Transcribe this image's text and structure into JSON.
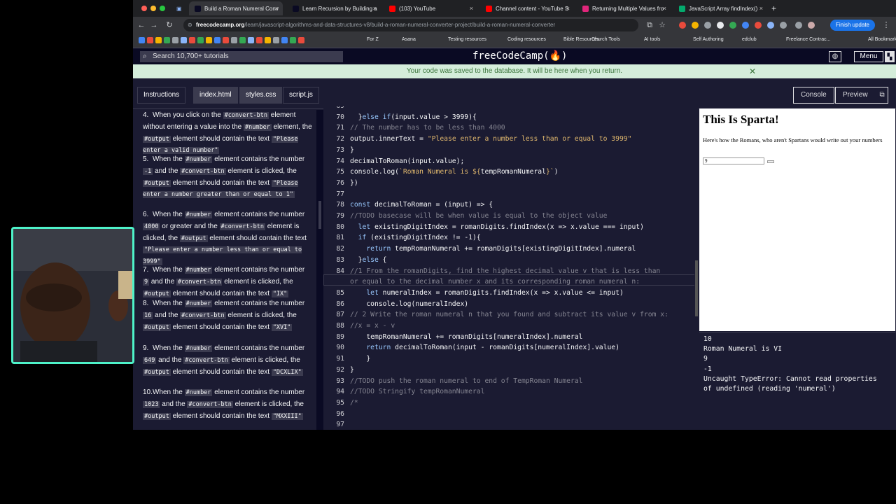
{
  "browser": {
    "tabs": [
      {
        "title": "Build a Roman Numeral Conv",
        "active": true,
        "fav_color": "#0a0a23"
      },
      {
        "title": "Learn Recursion by Building a",
        "active": false,
        "fav_color": "#0a0a23"
      },
      {
        "title": "(103) YouTube",
        "active": false,
        "fav_color": "#ff0000"
      },
      {
        "title": "Channel content - YouTube S",
        "active": false,
        "fav_color": "#ff0000"
      },
      {
        "title": "Returning Multiple Values fro",
        "active": false,
        "fav_color": "#e0267b"
      },
      {
        "title": "JavaScript Array findIndex()",
        "active": false,
        "fav_color": "#04aa6d"
      }
    ],
    "new_tab": "+",
    "url_host": "freecodecamp.org",
    "url_path": "/learn/javascript-algorithms-and-data-structures-v8/build-a-roman-numeral-converter-project/build-a-roman-numeral-converter",
    "finish_update": "Finish update",
    "bookmarks": [
      "For Z",
      "Asana",
      "Testing resources",
      "Coding resources",
      "Bible Resources",
      "Church Tools",
      "AI tools",
      "Self Authoring",
      "edclub",
      "Freelance Contrac...",
      "All Bookmarks"
    ]
  },
  "fcc": {
    "search_placeholder": "Search 10,700+ tutorials",
    "logo": "freeCodeCamp(🔥)",
    "menu": "Menu",
    "flash": "Your code was saved to the database. It will be here when you return.",
    "flash_close": "✕",
    "tabs": [
      "Instructions",
      "index.html",
      "styles.css",
      "script.js"
    ],
    "right_tabs": [
      "Console",
      "Preview"
    ]
  },
  "instructions": [
    {
      "n": "4.",
      "parts": [
        [
          "t",
          "When you click on the "
        ],
        [
          "c",
          "#convert-btn"
        ],
        [
          "t",
          " element without entering a value into the "
        ],
        [
          "c",
          "#number"
        ],
        [
          "t",
          " element, the "
        ],
        [
          "c",
          "#output"
        ],
        [
          "t",
          " element should contain the text "
        ],
        [
          "c",
          "\"Please enter a valid number\""
        ]
      ]
    },
    {
      "n": "5.",
      "parts": [
        [
          "t",
          "When the "
        ],
        [
          "c",
          "#number"
        ],
        [
          "t",
          " element contains the number "
        ],
        [
          "c",
          "-1"
        ],
        [
          "t",
          " and the "
        ],
        [
          "c",
          "#convert-btn"
        ],
        [
          "t",
          " element is clicked, the "
        ],
        [
          "c",
          "#output"
        ],
        [
          "t",
          " element should contain the text "
        ],
        [
          "c",
          "\"Please enter a number greater than or equal to 1\""
        ]
      ]
    },
    {
      "n": "6.",
      "parts": [
        [
          "t",
          "When the "
        ],
        [
          "c",
          "#number"
        ],
        [
          "t",
          " element contains the number "
        ],
        [
          "c",
          "4000"
        ],
        [
          "t",
          " or greater and the "
        ],
        [
          "c",
          "#convert-btn"
        ],
        [
          "t",
          " element is clicked, the "
        ],
        [
          "c",
          "#output"
        ],
        [
          "t",
          " element should contain the text "
        ],
        [
          "c",
          "\"Please enter a number less than or equal to 3999\""
        ]
      ]
    },
    {
      "n": "7.",
      "parts": [
        [
          "t",
          "When the "
        ],
        [
          "c",
          "#number"
        ],
        [
          "t",
          " element contains the number "
        ],
        [
          "c",
          "9"
        ],
        [
          "t",
          " and the "
        ],
        [
          "c",
          "#convert-btn"
        ],
        [
          "t",
          " element is clicked, the "
        ],
        [
          "c",
          "#output"
        ],
        [
          "t",
          " element should contain the text "
        ],
        [
          "c",
          "\"IX\""
        ]
      ]
    },
    {
      "n": "8.",
      "parts": [
        [
          "t",
          "When the "
        ],
        [
          "c",
          "#number"
        ],
        [
          "t",
          " element contains the number "
        ],
        [
          "c",
          "16"
        ],
        [
          "t",
          " and the "
        ],
        [
          "c",
          "#convert-btn"
        ],
        [
          "t",
          " element is clicked, the "
        ],
        [
          "c",
          "#output"
        ],
        [
          "t",
          " element should contain the text "
        ],
        [
          "c",
          "\"XVI\""
        ]
      ]
    },
    {
      "n": "9.",
      "parts": [
        [
          "t",
          "When the "
        ],
        [
          "c",
          "#number"
        ],
        [
          "t",
          " element contains the number "
        ],
        [
          "c",
          "649"
        ],
        [
          "t",
          " and the "
        ],
        [
          "c",
          "#convert-btn"
        ],
        [
          "t",
          " element is clicked, the "
        ],
        [
          "c",
          "#output"
        ],
        [
          "t",
          " element should contain the text "
        ],
        [
          "c",
          "\"DCXLIX\""
        ]
      ]
    },
    {
      "n": "10.",
      "parts": [
        [
          "t",
          "When the "
        ],
        [
          "c",
          "#number"
        ],
        [
          "t",
          " element contains the number "
        ],
        [
          "c",
          "1023"
        ],
        [
          "t",
          " and the "
        ],
        [
          "c",
          "#convert-btn"
        ],
        [
          "t",
          " element is clicked, the "
        ],
        [
          "c",
          "#output"
        ],
        [
          "t",
          " element should contain the text "
        ],
        [
          "c",
          "\"MXXIII\""
        ]
      ]
    }
  ],
  "editor": {
    "lines": [
      {
        "n": "69",
        "code": [
          [
            "p",
            ""
          ]
        ]
      },
      {
        "n": "70",
        "code": [
          [
            "p",
            "  }"
          ],
          [
            "k",
            "else if"
          ],
          [
            "p",
            "(input.value > 3999){"
          ]
        ]
      },
      {
        "n": "71",
        "code": [
          [
            "c",
            "// The number has to be less than 4000"
          ]
        ]
      },
      {
        "n": "72",
        "code": [
          [
            "p",
            "output.innerText = "
          ],
          [
            "s",
            "\"Please enter a number less than or equal to 3999\""
          ]
        ]
      },
      {
        "n": "73",
        "code": [
          [
            "p",
            "}"
          ]
        ]
      },
      {
        "n": "74",
        "code": [
          [
            "p",
            "decimalToRoman(input.value);"
          ]
        ]
      },
      {
        "n": "75",
        "code": [
          [
            "p",
            "console.log("
          ],
          [
            "s",
            "`Roman Numeral is ${"
          ],
          [
            "p",
            "tempRomanNumeral"
          ],
          [
            "s",
            "}`"
          ],
          [
            "p",
            ")"
          ]
        ]
      },
      {
        "n": "76",
        "code": [
          [
            "p",
            "})"
          ]
        ]
      },
      {
        "n": "77",
        "code": [
          [
            "p",
            ""
          ]
        ]
      },
      {
        "n": "78",
        "code": [
          [
            "k",
            "const"
          ],
          [
            "p",
            " decimalToRoman = (input) => {"
          ]
        ]
      },
      {
        "n": "79",
        "code": [
          [
            "c",
            "//TODO basecase will be when value is equal to the object value"
          ]
        ]
      },
      {
        "n": "80",
        "code": [
          [
            "p",
            "  "
          ],
          [
            "k",
            "let"
          ],
          [
            "p",
            " existingDigitIndex = romanDigits.findIndex(x => x.value === input)"
          ]
        ]
      },
      {
        "n": "81",
        "code": [
          [
            "p",
            "  "
          ],
          [
            "k",
            "if"
          ],
          [
            "p",
            " (existingDigitIndex != -1){"
          ]
        ]
      },
      {
        "n": "82",
        "code": [
          [
            "p",
            "    "
          ],
          [
            "k",
            "return"
          ],
          [
            "p",
            " tempRomanNumeral += romanDigits[existingDigitIndex].numeral"
          ]
        ]
      },
      {
        "n": "83",
        "code": [
          [
            "p",
            "  }"
          ],
          [
            "k",
            "else"
          ],
          [
            "p",
            " {"
          ]
        ]
      },
      {
        "n": "84",
        "code": [
          [
            "c",
            "//1 From the romanDigits, find the highest decimal value v that is less than"
          ]
        ]
      },
      {
        "n": "",
        "code": [
          [
            "c",
            "or equal to the decimal number x and its corresponding roman numeral n:"
          ]
        ]
      },
      {
        "n": "85",
        "code": [
          [
            "p",
            "    "
          ],
          [
            "k",
            "let"
          ],
          [
            "p",
            " numeralIndex = romanDigits.findIndex(x => x.value <= input)"
          ]
        ]
      },
      {
        "n": "86",
        "code": [
          [
            "p",
            "    console.log(numeralIndex)"
          ]
        ]
      },
      {
        "n": "87",
        "code": [
          [
            "c",
            "// 2 Write the roman numeral n that you found and subtract its value v from x:"
          ]
        ]
      },
      {
        "n": "88",
        "code": [
          [
            "c",
            "//x = x - v"
          ]
        ]
      },
      {
        "n": "89",
        "code": [
          [
            "p",
            "    tempRomanNumeral += romanDigits[numeralIndex].numeral"
          ]
        ]
      },
      {
        "n": "90",
        "code": [
          [
            "p",
            "    "
          ],
          [
            "k",
            "return"
          ],
          [
            "p",
            " decimalToRoman(input - romanDigits[numeralIndex].value)"
          ]
        ]
      },
      {
        "n": "91",
        "code": [
          [
            "p",
            "    }"
          ]
        ]
      },
      {
        "n": "92",
        "code": [
          [
            "p",
            "}"
          ]
        ]
      },
      {
        "n": "93",
        "code": [
          [
            "c",
            "//TODO push the roman numeral to end of TempRoman Numeral"
          ]
        ]
      },
      {
        "n": "94",
        "code": [
          [
            "c",
            "//TODO Stringify tempRomanNumeral"
          ]
        ]
      },
      {
        "n": "95",
        "code": [
          [
            "c",
            "/*"
          ]
        ]
      },
      {
        "n": "96",
        "code": [
          [
            "p",
            ""
          ]
        ]
      },
      {
        "n": "97",
        "code": [
          [
            "p",
            ""
          ]
        ]
      }
    ]
  },
  "preview": {
    "title": "This Is Sparta!",
    "subtitle": "Here's how the Romans, who aren't Spartans would write out your numbers",
    "input_value": "9"
  },
  "console": [
    "10",
    "Roman Numeral is VI",
    "9",
    "-1",
    "Uncaught TypeError: Cannot read properties",
    "of undefined (reading 'numeral')"
  ]
}
